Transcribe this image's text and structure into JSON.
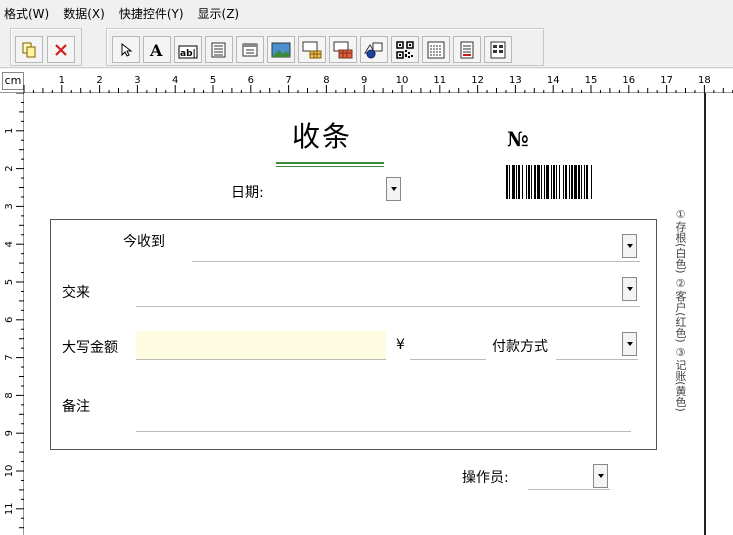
{
  "menu": [
    {
      "label": "格式(W)"
    },
    {
      "label": "数据(X)"
    },
    {
      "label": "快捷控件(Y)"
    },
    {
      "label": "显示(Z)"
    }
  ],
  "toolbar": {
    "group1": [
      "copy-icon",
      "delete-icon"
    ],
    "group2": [
      "pointer-icon",
      "text-icon",
      "textbox-icon",
      "list-icon",
      "window-icon",
      "image-icon",
      "table-icon",
      "grid-table-icon",
      "shape-icon",
      "qrcode-icon",
      "list-lines-icon",
      "doc-icon",
      "columns-icon"
    ]
  },
  "ruler": {
    "unit": "cm",
    "h_labels": [
      "1",
      "2",
      "3",
      "4",
      "5",
      "6",
      "7",
      "8",
      "9",
      "10",
      "11",
      "12",
      "13",
      "14",
      "15",
      "16",
      "17",
      "18"
    ],
    "v_labels": [
      "1",
      "2",
      "3",
      "4",
      "5",
      "6",
      "7",
      "8",
      "9",
      "10",
      "11"
    ]
  },
  "form": {
    "title": "收条",
    "number_label": "№",
    "date_label": "日期:",
    "received_from_label": "今收到",
    "deliver_label": "交来",
    "amount_label": "大写金额",
    "currency_symbol": "¥",
    "payment_method_label": "付款方式",
    "remark_label": "备注",
    "operator_label": "操作员:",
    "copies_note": "①存根(白色) ②客户(红色) ③记账(黄色)"
  },
  "colors": {
    "amount_field_bg": "#fdfbe0",
    "title_underline": "#3a8a3a",
    "delete_icon": "#d02020"
  }
}
